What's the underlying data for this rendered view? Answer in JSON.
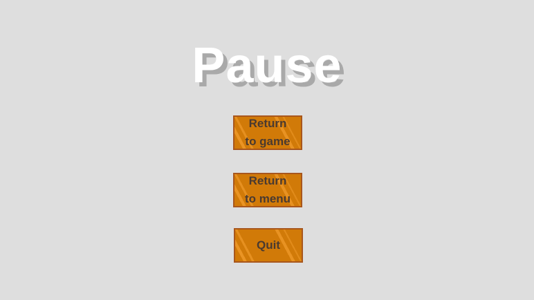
{
  "pause_menu": {
    "title": "Pause",
    "buttons": [
      {
        "label": "Return\nto game"
      },
      {
        "label": "Return\nto menu"
      },
      {
        "label": "Quit"
      }
    ],
    "colors": {
      "background": "#dedede",
      "title": "#ffffff",
      "title_shadow": "#a9a9a9",
      "button_fill": "#d17a08",
      "button_border": "#a8561c",
      "button_text": "#4a3a30"
    }
  }
}
